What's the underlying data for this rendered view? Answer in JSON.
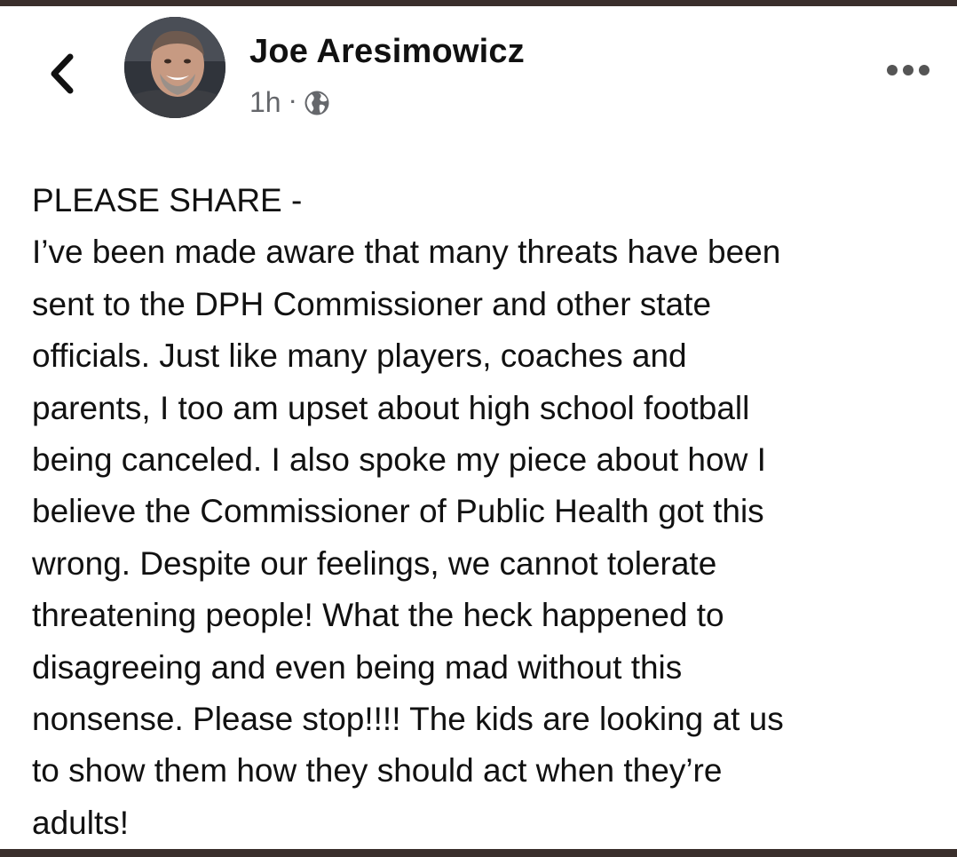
{
  "post": {
    "author": "Joe Aresimowicz",
    "timestamp": "1h",
    "separator": "·",
    "visibility_icon": "globe-icon",
    "text": "PLEASE SHARE -\nI’ve been made aware that many threats have been\nsent to the DPH Commissioner and other state\nofficials. Just like many players, coaches and\nparents, I too am upset about high school football\nbeing canceled. I also spoke my piece about how I\nbelieve the Commissioner of Public Health got this\nwrong. Despite our feelings, we cannot tolerate\nthreatening people! What the heck happened to\ndisagreeing and even being mad without this\nnonsense. Please stop!!!! The kids are looking at us\nto show them how they should act when they’re\nadults!"
  },
  "header": {
    "back_icon": "chevron-left-icon",
    "more_icon": "more-options-icon"
  },
  "colors": {
    "frame": "#3a2f2c",
    "background": "#ffffff",
    "text": "#111111",
    "meta": "#65676b"
  }
}
